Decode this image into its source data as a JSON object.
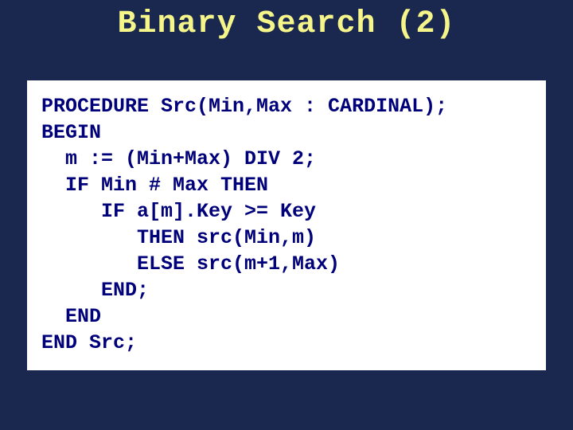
{
  "title": "Binary Search (2)",
  "code": "PROCEDURE Src(Min,Max : CARDINAL);\nBEGIN\n  m := (Min+Max) DIV 2;\n  IF Min # Max THEN\n     IF a[m].Key >= Key\n        THEN src(Min,m)\n        ELSE src(m+1,Max)\n     END;\n  END\nEND Src;"
}
